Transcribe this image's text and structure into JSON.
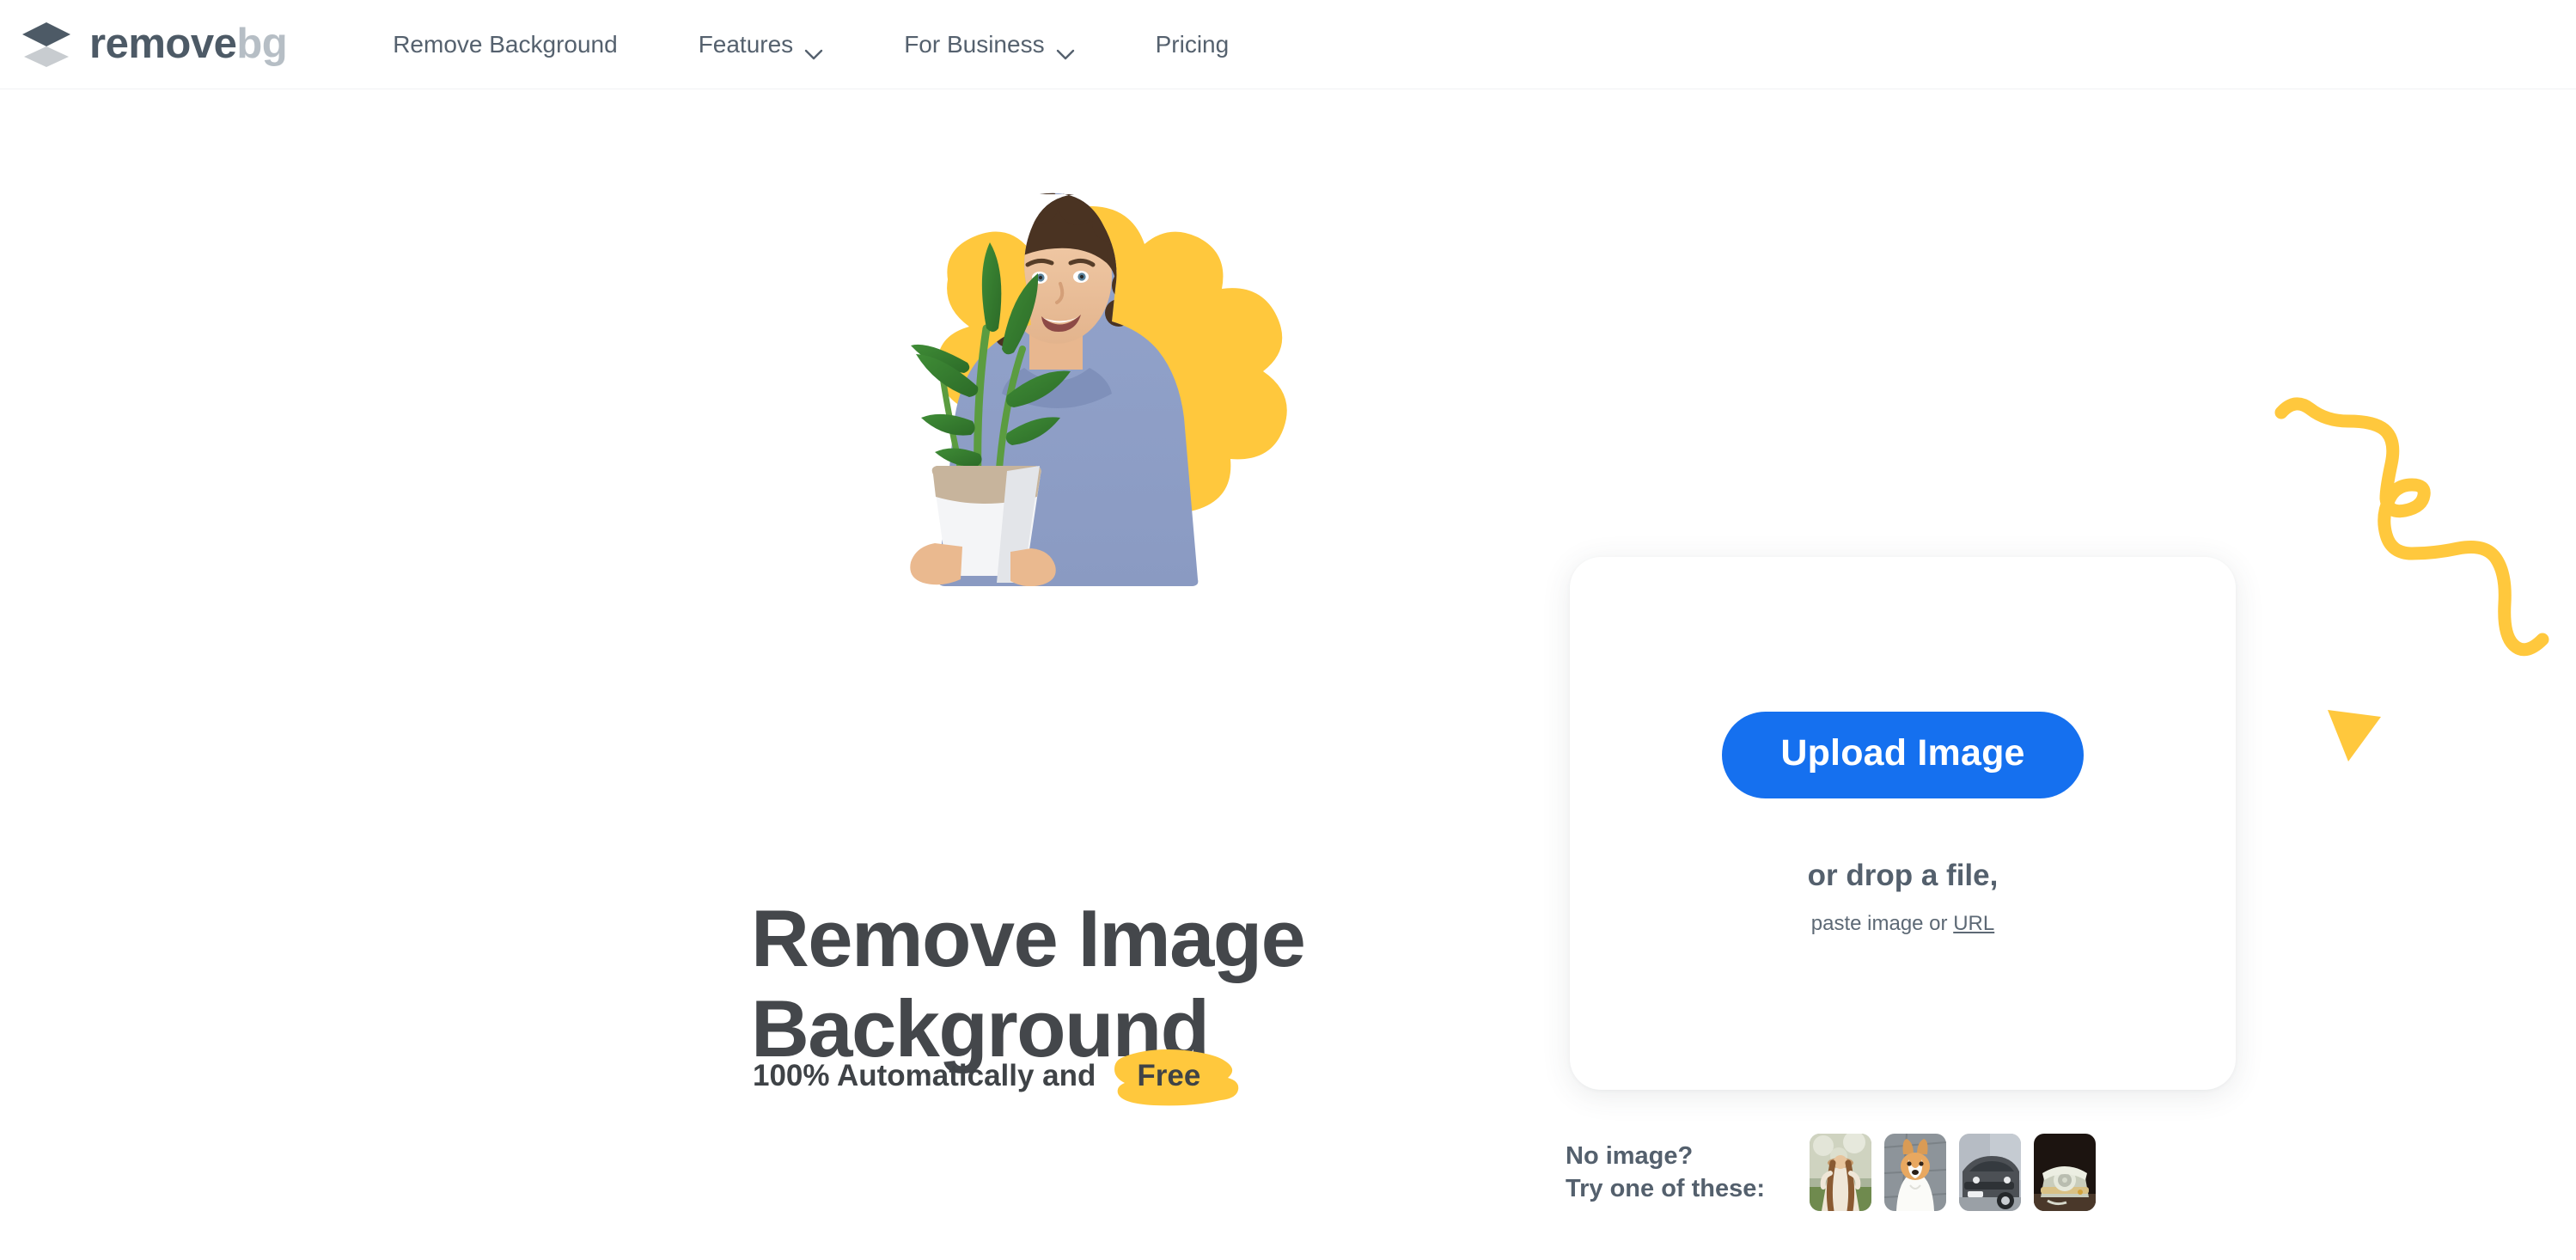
{
  "brand": {
    "name_primary": "remove",
    "name_secondary": "bg",
    "logo_icon": "layers-diamond-icon"
  },
  "nav": {
    "items": [
      {
        "label": "Remove Background",
        "has_dropdown": false,
        "icon": ""
      },
      {
        "label": "Features",
        "has_dropdown": true,
        "icon": "chevron-down-icon"
      },
      {
        "label": "For Business",
        "has_dropdown": true,
        "icon": "chevron-down-icon"
      },
      {
        "label": "Pricing",
        "has_dropdown": false,
        "icon": ""
      }
    ]
  },
  "hero": {
    "art_alt": "man-holding-potted-plant-photo",
    "headline_line1": "Remove Image",
    "headline_line2": "Background",
    "subline_prefix": "100% Automatically and",
    "subline_highlight": "Free"
  },
  "upload": {
    "button_label": "Upload Image",
    "drop_text": "or drop a file,",
    "paste_prefix": "paste image or",
    "url_link": "URL"
  },
  "samples": {
    "label_line1": "No image?",
    "label_line2": "Try one of these:",
    "thumbnails": [
      {
        "name": "sample-woman-in-hat",
        "alt": "woman in hat outdoors"
      },
      {
        "name": "sample-corgi-dog",
        "alt": "corgi dog on pavement"
      },
      {
        "name": "sample-grey-car",
        "alt": "grey car front view"
      },
      {
        "name": "sample-rotary-telephone",
        "alt": "vintage rotary telephone"
      }
    ]
  },
  "decor": {
    "squiggle": "yellow-squiggle-line",
    "triangle": "yellow-triangle"
  },
  "colors": {
    "accent_blue": "#1570ef",
    "accent_yellow": "#ffc83d",
    "text_dark": "#44474b",
    "text_muted": "#54606d",
    "logo_dark": "#4d5a66",
    "logo_light": "#b6bec5",
    "page_bg": "#ffffff"
  }
}
